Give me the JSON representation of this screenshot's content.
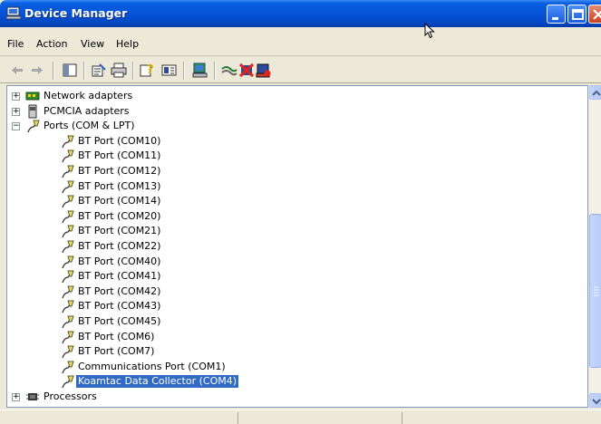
{
  "window": {
    "title": "Device Manager"
  },
  "menu": [
    {
      "label": "File"
    },
    {
      "label": "Action"
    },
    {
      "label": "View"
    },
    {
      "label": "Help"
    }
  ],
  "toolbar": {
    "icons": [
      "back-arrow-icon",
      "forward-arrow-icon",
      "console-tree-icon",
      "properties-icon",
      "print-icon",
      "help-icon",
      "details-view-icon",
      "scan-hardware-icon",
      "update-driver-icon",
      "uninstall-icon",
      "disable-device-icon"
    ]
  },
  "tree": {
    "categories": [
      {
        "label": "Network adapters",
        "expanded": false,
        "icon": "network-card-icon"
      },
      {
        "label": "PCMCIA adapters",
        "expanded": false,
        "icon": "pcmcia-icon"
      },
      {
        "label": "Ports (COM & LPT)",
        "expanded": true,
        "icon": "port-icon"
      }
    ],
    "ports": [
      "BT Port (COM10)",
      "BT Port (COM11)",
      "BT Port (COM12)",
      "BT Port (COM13)",
      "BT Port (COM14)",
      "BT Port (COM20)",
      "BT Port (COM21)",
      "BT Port (COM22)",
      "BT Port (COM40)",
      "BT Port (COM41)",
      "BT Port (COM42)",
      "BT Port (COM43)",
      "BT Port (COM45)",
      "BT Port (COM6)",
      "BT Port (COM7)",
      "Communications Port (COM1)",
      "Koamtac Data Collector (COM4)"
    ],
    "selected": "Koamtac Data Collector (COM4)",
    "after": [
      {
        "label": "Processors",
        "expanded": false,
        "icon": "processor-icon"
      }
    ]
  },
  "colors": {
    "titlebar": "#0553d6",
    "selection": "#316ac5",
    "chrome": "#ECE9D8"
  }
}
